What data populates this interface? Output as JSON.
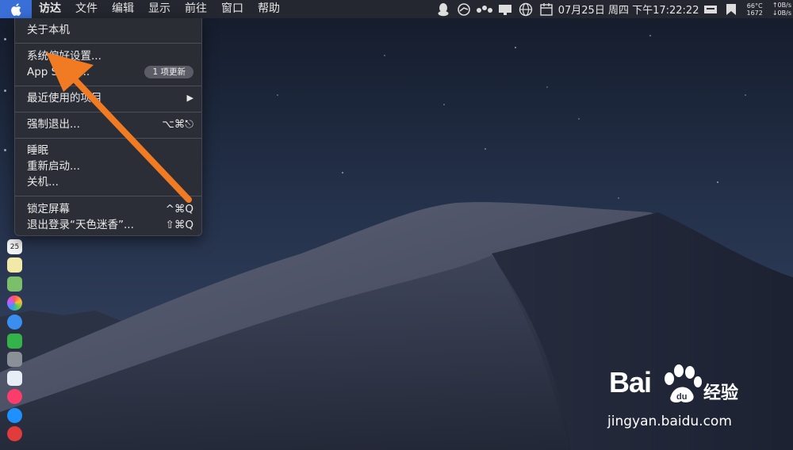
{
  "menubar": {
    "app_name": "访达",
    "items": [
      "文件",
      "编辑",
      "显示",
      "前往",
      "窗口",
      "帮助"
    ],
    "datetime": "07月25日 周四 下午17:22:22",
    "temperature": "66°C",
    "fan_speed": "1672",
    "net_up": "↑0B/s",
    "net_down": "↓0B/s",
    "icons": [
      "qq-icon",
      "sync-icon",
      "dots-icon",
      "display-icon",
      "globe-icon",
      "calendar-icon",
      "input-source-icon",
      "widget-icon"
    ]
  },
  "apple_menu": {
    "about": "关于本机",
    "system_prefs": "系统偏好设置...",
    "app_store": "App Store...",
    "app_store_badge": "1 项更新",
    "recent_items": "最近使用的项目",
    "recent_arrow": "▶",
    "force_quit": "强制退出...",
    "force_quit_shortcut": "⌥⌘⎋",
    "sleep": "睡眠",
    "restart": "重新启动...",
    "shutdown": "关机...",
    "lock_screen": "锁定屏幕",
    "lock_shortcut": "^⌘Q",
    "logout": "退出登录“天色迷香”...",
    "logout_shortcut": "⇧⌘Q"
  },
  "dock": {
    "calendar_day": "25"
  },
  "watermark": {
    "brand": "Bai",
    "brand_cn": "经验",
    "url": "jingyan.baidu.com"
  },
  "colors": {
    "arrow": "#f07b22",
    "menu_bg": "#2c2e36",
    "apple_highlight": "#3a6fd8"
  }
}
